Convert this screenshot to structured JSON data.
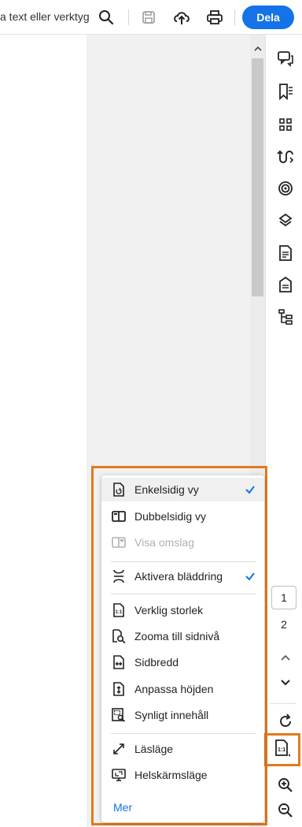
{
  "toolbar": {
    "search_text": "a text eller verktyg",
    "share_label": "Dela"
  },
  "menu": {
    "items": [
      {
        "label": "Enkelsidig vy",
        "icon": "single-page-icon",
        "checked": true,
        "selected": true
      },
      {
        "label": "Dubbelsidig vy",
        "icon": "two-page-icon"
      },
      {
        "label": "Visa omslag",
        "icon": "cover-page-icon",
        "disabled": true
      },
      {
        "label": "Aktivera bläddring",
        "icon": "scrolling-icon",
        "checked": true
      },
      {
        "label": "Verklig storlek",
        "icon": "actual-size-icon"
      },
      {
        "label": "Zooma till sidnivå",
        "icon": "zoom-page-icon"
      },
      {
        "label": "Sidbredd",
        "icon": "fit-width-icon"
      },
      {
        "label": "Anpassa höjden",
        "icon": "fit-height-icon"
      },
      {
        "label": "Synligt innehåll",
        "icon": "fit-visible-icon"
      },
      {
        "label": "Läsläge",
        "icon": "reading-mode-icon"
      },
      {
        "label": "Helskärmsläge",
        "icon": "full-screen-icon"
      }
    ],
    "more_label": "Mer"
  },
  "pagination": {
    "current_page": "1",
    "total_pages": "2"
  },
  "colors": {
    "accent": "#1473e6",
    "highlight": "#e07b1c"
  }
}
